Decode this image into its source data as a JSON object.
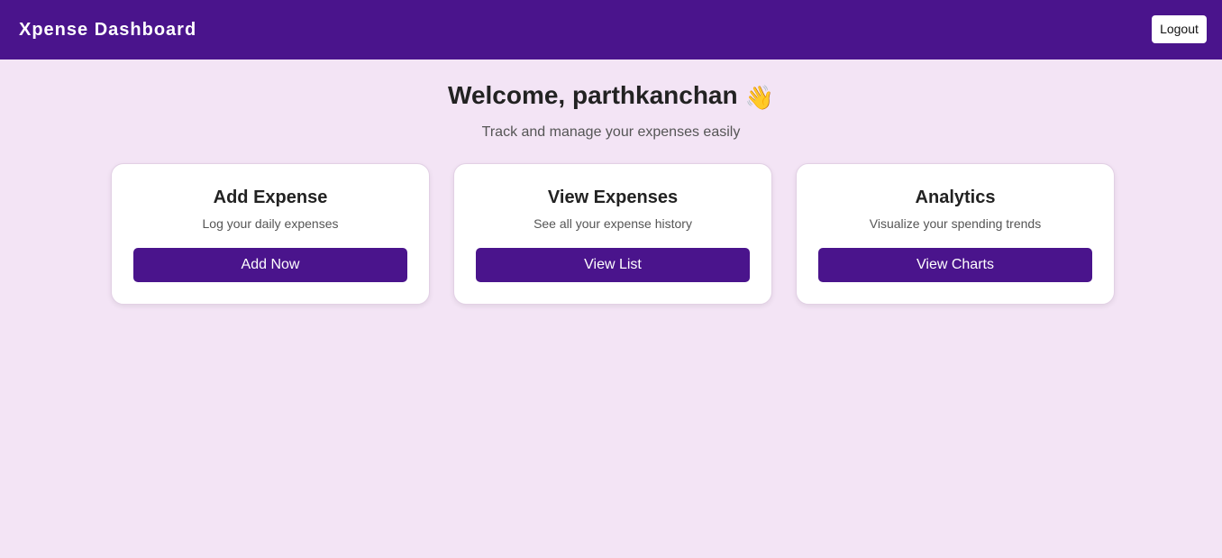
{
  "header": {
    "title": "Xpense Dashboard",
    "logout_label": "Logout"
  },
  "hero": {
    "welcome": "Welcome, parthkanchan",
    "wave_emoji": "👋",
    "subtitle": "Track and manage your expenses easily"
  },
  "cards": [
    {
      "title": "Add Expense",
      "description": "Log your daily expenses",
      "button": "Add Now"
    },
    {
      "title": "View Expenses",
      "description": "See all your expense history",
      "button": "View List"
    },
    {
      "title": "Analytics",
      "description": "Visualize your spending trends",
      "button": "View Charts"
    }
  ],
  "colors": {
    "primary": "#4a148c",
    "background": "#f3e4f5",
    "card": "#ffffff"
  },
  "icons": {
    "wave": "waving-hand-icon"
  }
}
